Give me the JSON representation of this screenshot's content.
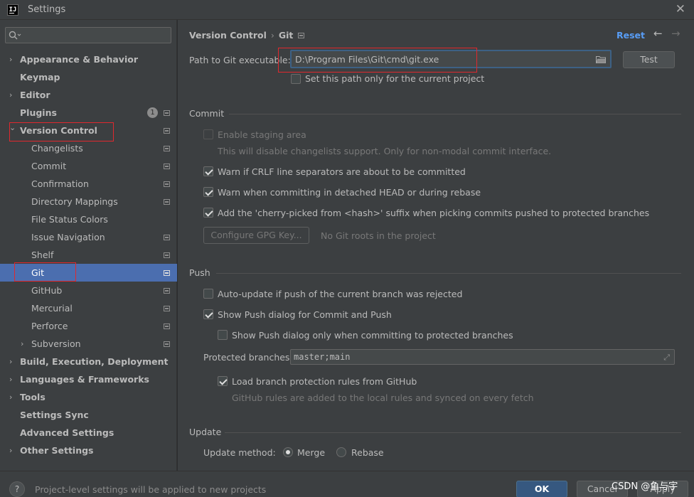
{
  "window": {
    "app_icon": "IJ",
    "title": "Settings"
  },
  "search": {
    "value": "",
    "placeholder": ""
  },
  "sidebar": {
    "items": [
      {
        "label": "Appearance & Behavior",
        "bold": true,
        "arrow": "collapsed"
      },
      {
        "label": "Keymap",
        "bold": true
      },
      {
        "label": "Editor",
        "bold": true,
        "arrow": "collapsed"
      },
      {
        "label": "Plugins",
        "bold": true,
        "badge": "1"
      },
      {
        "label": "Version Control",
        "bold": true,
        "arrow": "expanded"
      },
      {
        "label": "Changelists"
      },
      {
        "label": "Commit"
      },
      {
        "label": "Confirmation"
      },
      {
        "label": "Directory Mappings"
      },
      {
        "label": "File Status Colors"
      },
      {
        "label": "Issue Navigation"
      },
      {
        "label": "Shelf"
      },
      {
        "label": "Git",
        "selected": true
      },
      {
        "label": "GitHub"
      },
      {
        "label": "Mercurial"
      },
      {
        "label": "Perforce"
      },
      {
        "label": "Subversion",
        "arrow": "collapsed"
      },
      {
        "label": "Build, Execution, Deployment",
        "bold": true,
        "arrow": "collapsed"
      },
      {
        "label": "Languages & Frameworks",
        "bold": true,
        "arrow": "collapsed"
      },
      {
        "label": "Tools",
        "bold": true,
        "arrow": "collapsed"
      },
      {
        "label": "Settings Sync",
        "bold": true
      },
      {
        "label": "Advanced Settings",
        "bold": true
      },
      {
        "label": "Other Settings",
        "bold": true,
        "arrow": "collapsed"
      }
    ]
  },
  "header": {
    "breadcrumb_parent": "Version Control",
    "breadcrumb_sep": "›",
    "breadcrumb_current": "Git",
    "reset_label": "Reset",
    "back_icon": "arrow-left-icon",
    "forward_icon": "arrow-right-icon"
  },
  "git": {
    "path_label": "Path to Git executable:",
    "path_value": "D:\\Program Files\\Git\\cmd\\git.exe",
    "test_label": "Test",
    "project_only_label": "Set this path only for the current project",
    "project_only_checked": false
  },
  "commit": {
    "section": "Commit",
    "staging_label": "Enable staging area",
    "staging_hint": "This will disable changelists support. Only for non-modal commit interface.",
    "crlf_label": "Warn if CRLF line separators are about to be committed",
    "detached_label": "Warn when committing in detached HEAD or during rebase",
    "cherry_label": "Add the 'cherry-picked from <hash>' suffix when picking commits pushed to protected branches",
    "gpg_button": "Configure GPG Key...",
    "gpg_status": "No Git roots in the project"
  },
  "push": {
    "section": "Push",
    "auto_update_label": "Auto-update if push of the current branch was rejected",
    "show_dialog_label": "Show Push dialog for Commit and Push",
    "protected_only_label": "Show Push dialog only when committing to protected branches",
    "protected_label": "Protected branches:",
    "protected_value": "master;main",
    "load_rules_label": "Load branch protection rules from GitHub",
    "load_rules_hint": "GitHub rules are added to the local rules and synced on every fetch"
  },
  "update": {
    "section": "Update",
    "method_label": "Update method:",
    "merge_label": "Merge",
    "rebase_label": "Rebase",
    "selected_method": "Merge"
  },
  "footer": {
    "help_label": "?",
    "message": "Project-level settings will be applied to new projects",
    "ok_label": "OK",
    "cancel_label": "Cancel",
    "apply_label": "Apply"
  },
  "watermark": "CSDN @鱼与宇",
  "colors": {
    "accent": "#4b6eaf",
    "link": "#589df6",
    "annotation_red": "#e0282e"
  }
}
